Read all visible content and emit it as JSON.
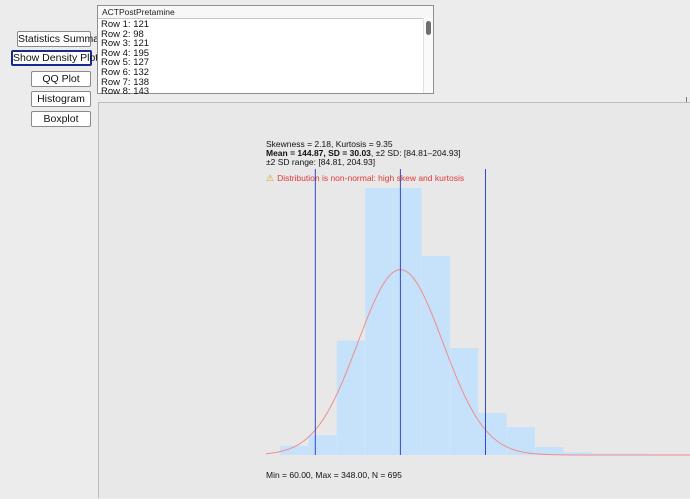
{
  "sidebar": {
    "buttons": [
      {
        "label": "Statistics Summary"
      },
      {
        "label": "Show Density Plot"
      },
      {
        "label": "QQ Plot"
      },
      {
        "label": "Histogram"
      },
      {
        "label": "Boxplot"
      }
    ]
  },
  "listbox": {
    "header": "ACTPostPretamine",
    "rows": [
      "Row 1: 121",
      "Row 2: 98",
      "Row 3: 121",
      "Row 4: 195",
      "Row 5: 127",
      "Row 6: 132",
      "Row 7: 138",
      "Row 8: 143"
    ]
  },
  "plot": {
    "skew_line": "Skewness = 2.18, Kurtosis = 9.35",
    "mean_line": "Mean = 144.87, SD = 30.03",
    "sd_line": ", ±2 SD: [84.81–204.93]",
    "range_line": "±2 SD range: [84.81, 204.93]",
    "warning": "Distribution is non-normal: high skew and kurtosis",
    "warning_icon": "warning-triangle-icon",
    "footer": "Min = 60.00, Max = 348.00, N = 695",
    "colors": {
      "bar": "#c6e2fb",
      "curve": "#f08c8c",
      "vline": "#3348c8",
      "warning": "#e03a36"
    }
  },
  "chart_data": {
    "type": "bar",
    "bin_edges": [
      60,
      80,
      100,
      120,
      140,
      160,
      180,
      200,
      220,
      240,
      260,
      280,
      300,
      320,
      340,
      348
    ],
    "values": [
      0.000666,
      0.001425,
      0.008203,
      0.019138,
      0.019138,
      0.014255,
      0.007666,
      0.003009,
      0.002,
      0.000576,
      0.000191,
      9.6e-05,
      9.6e-05,
      4.8e-05,
      4.8e-05
    ],
    "density_curve": {
      "mean": 144.87,
      "sd": 30.03
    },
    "vlines": [
      84.81,
      144.87,
      204.93
    ],
    "xlim": [
      50,
      350
    ],
    "ylim": [
      0,
      0.0205
    ]
  }
}
